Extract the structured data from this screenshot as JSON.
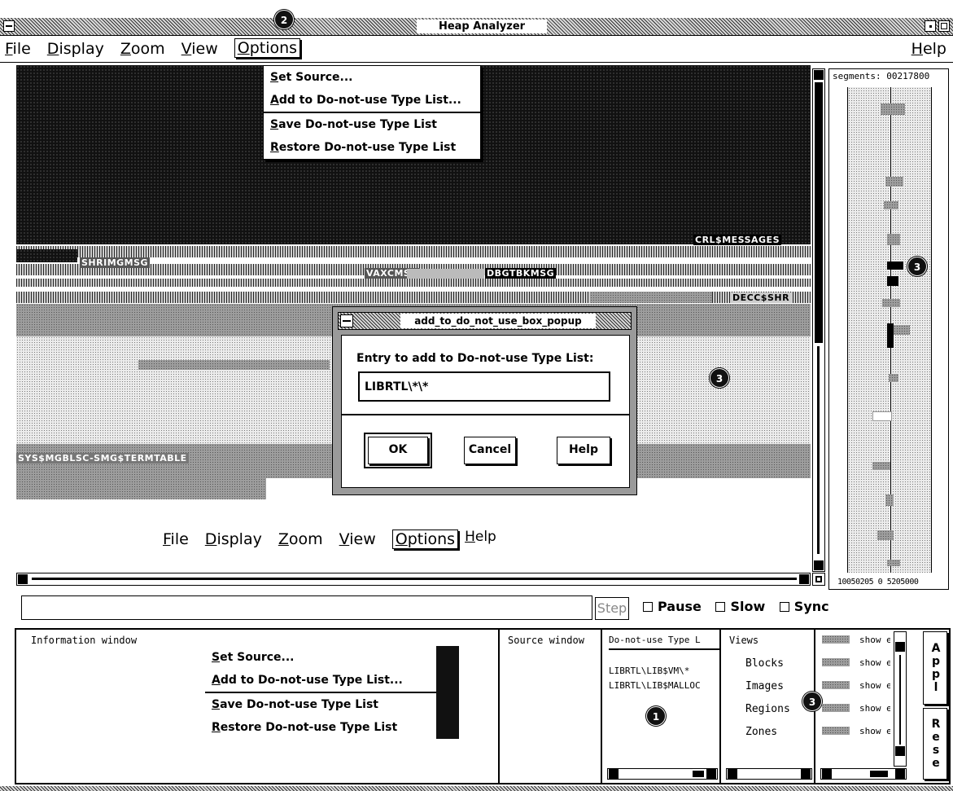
{
  "window": {
    "title": "Heap Analyzer"
  },
  "menubar": {
    "items": [
      {
        "label": "File",
        "key": "F",
        "rest": "ile"
      },
      {
        "label": "Display",
        "key": "D",
        "rest": "isplay"
      },
      {
        "label": "Zoom",
        "key": "Z",
        "rest": "oom"
      },
      {
        "label": "View",
        "key": "V",
        "rest": "iew"
      },
      {
        "label": "Options",
        "key": "O",
        "rest": "ptions"
      }
    ],
    "help": {
      "key": "H",
      "rest": "elp"
    }
  },
  "options_menu": {
    "items": [
      {
        "key": "S",
        "rest": "et Source..."
      },
      {
        "key": "A",
        "rest": "dd to Do-not-use Type List..."
      },
      {
        "key": "S",
        "rest": "ave Do-not-use Type List"
      },
      {
        "key": "R",
        "rest": "estore Do-not-use Type List"
      }
    ]
  },
  "memory_map": {
    "labels": {
      "crl": "CRL$MESSAGES",
      "shrimg": "SHRIMGMSG",
      "vax": "VAXCMSG",
      "dbg": "DBGTBKMSG",
      "decc": "DECC$SHR",
      "sys": "SYS$MGBLSC-SMG$TERMTABLE"
    }
  },
  "dialog": {
    "title": "add_to_do_not_use_box_popup",
    "prompt": "Entry to add to Do-not-use Type List:",
    "input_value": "LIBRTL\\*\\*",
    "ok": "OK",
    "cancel": "Cancel",
    "help": "Help"
  },
  "callout_menubar": {
    "items": [
      {
        "key": "F",
        "rest": "ile"
      },
      {
        "key": "D",
        "rest": "isplay"
      },
      {
        "key": "Z",
        "rest": "oom"
      },
      {
        "key": "V",
        "rest": "iew"
      },
      {
        "key": "O",
        "rest": "ptions"
      },
      {
        "key": "H",
        "rest": "elp"
      }
    ]
  },
  "segments": {
    "header": "segments: 00217800",
    "scale": "10050205 0 5205000"
  },
  "controls": {
    "step": "Step",
    "pause": "Pause",
    "slow": "Slow",
    "sync": "Sync"
  },
  "panes": {
    "info_title": "Information window",
    "source_title": "Source window",
    "dnu_title": "Do-not-use Type L",
    "dnu_items": [
      "LIBRTL\\LIB$VM\\*",
      "LIBRTL\\LIB$MALLOC"
    ],
    "views_title": "Views",
    "views_items": [
      "Blocks",
      "Images",
      "Regions",
      "Zones"
    ],
    "show_items": [
      "show ex",
      "show ex",
      "show ex",
      "show ex",
      "show ex"
    ],
    "side_buttons": [
      "Appl",
      "Rese"
    ]
  },
  "callouts": {
    "one": "1",
    "two": "2",
    "three": "3"
  },
  "colors": {
    "background": "#ffffff",
    "foreground": "#000000",
    "highlight": "#111111"
  }
}
